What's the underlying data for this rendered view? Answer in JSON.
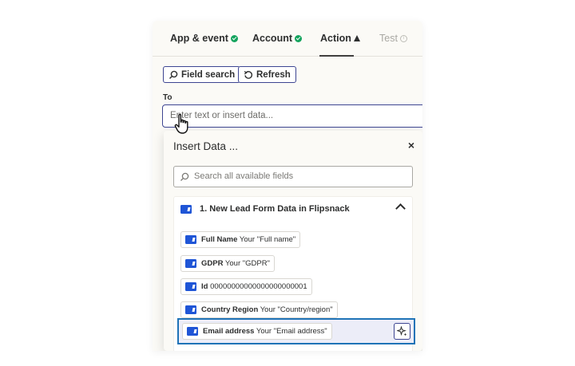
{
  "tabs": [
    {
      "label": "App & event",
      "status": "complete"
    },
    {
      "label": "Account",
      "status": "complete"
    },
    {
      "label": "Action",
      "status": "warning"
    },
    {
      "label": "Test",
      "status": "info"
    }
  ],
  "toolbar": {
    "field_search": "Field search",
    "refresh": "Refresh"
  },
  "to_field": {
    "label": "To",
    "placeholder": "Enter text or insert data..."
  },
  "insert_data": {
    "title": "Insert Data ...",
    "close": "×",
    "search_placeholder": "Search all available fields",
    "group_title": "1. New Lead Form Data in Flipsnack",
    "fields": [
      {
        "key": "Full Name",
        "value": "Your \"Full name\""
      },
      {
        "key": "GDPR",
        "value": "Your \"GDPR\""
      },
      {
        "key": "Id",
        "value": "00000000000000000000001"
      },
      {
        "key": "Country Region",
        "value": "Your \"Country/region\""
      },
      {
        "key": "Email address",
        "value": "Your \"Email address\""
      }
    ]
  },
  "colors": {
    "accent": "#3d4592",
    "success": "#13a35d",
    "app_icon": "#1f55d6",
    "highlight_border": "#1f73b7"
  }
}
